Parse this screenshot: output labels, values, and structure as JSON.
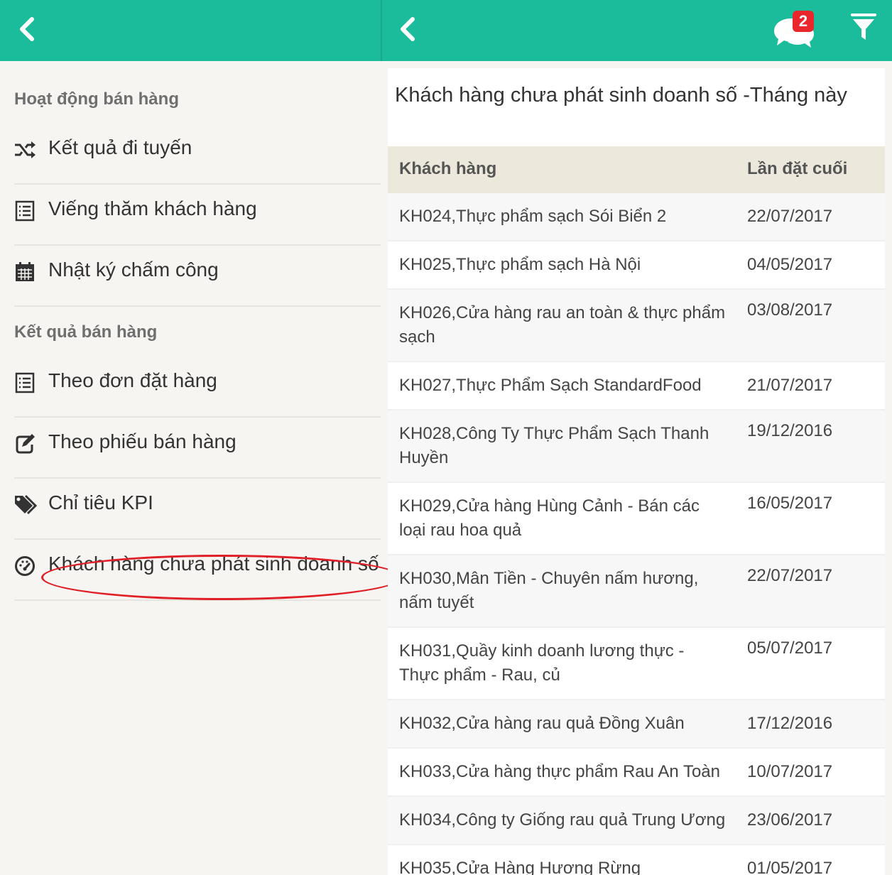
{
  "header": {
    "notification_count": "2",
    "brand_color": "#1bbc9b",
    "icons": [
      "back-chevron-icon",
      "chat-bubbles-icon",
      "filter-funnel-icon"
    ]
  },
  "sidebar": {
    "section_activity": "Hoạt động bán hàng",
    "section_results": "Kết quả bán hàng",
    "items": [
      {
        "label": "Kết quả đi tuyến",
        "icon": "shuffle-icon"
      },
      {
        "label": "Viếng thăm khách hàng",
        "icon": "list-icon"
      },
      {
        "label": "Nhật ký chấm công",
        "icon": "calendar-icon"
      },
      {
        "label": "Theo đơn đặt hàng",
        "icon": "list-icon"
      },
      {
        "label": "Theo phiếu bán hàng",
        "icon": "edit-icon"
      },
      {
        "label": "Chỉ tiêu KPI",
        "icon": "tags-icon"
      },
      {
        "label": "Khách hàng chưa phát sinh doanh số",
        "icon": "dashboard-icon"
      }
    ]
  },
  "content": {
    "title": "Khách hàng chưa phát sinh doanh số -Tháng này",
    "columns": [
      "Khách hàng",
      "Lần đặt cuối"
    ],
    "rows": [
      {
        "name": "KH024,Thực phẩm sạch Sói Biển 2",
        "date": "22/07/2017"
      },
      {
        "name": "KH025,Thực phẩm sạch Hà Nội",
        "date": "04/05/2017"
      },
      {
        "name": "KH026,Cửa hàng rau an toàn & thực phẩm sạch",
        "date": "03/08/2017"
      },
      {
        "name": "KH027,Thực Phẩm Sạch StandardFood",
        "date": "21/07/2017"
      },
      {
        "name": "KH028,Công Ty Thực Phẩm Sạch Thanh Huyền",
        "date": "19/12/2016"
      },
      {
        "name": "KH029,Cửa hàng Hùng Cảnh - Bán các loại rau hoa quả",
        "date": "16/05/2017"
      },
      {
        "name": "KH030,Mân Tiền - Chuyên nấm hương, nấm tuyết",
        "date": "22/07/2017"
      },
      {
        "name": "KH031,Quầy kinh doanh lương thực - Thực phẩm - Rau, củ",
        "date": "05/07/2017"
      },
      {
        "name": "KH032,Cửa hàng rau quả Đồng Xuân",
        "date": "17/12/2016"
      },
      {
        "name": "KH033,Cửa hàng thực phẩm Rau An Toàn",
        "date": "10/07/2017"
      },
      {
        "name": "KH034,Công ty Giống rau quả Trung Ương",
        "date": "23/06/2017"
      },
      {
        "name": "KH035,Cửa Hàng Hương Rừng",
        "date": "01/05/2017"
      }
    ]
  }
}
